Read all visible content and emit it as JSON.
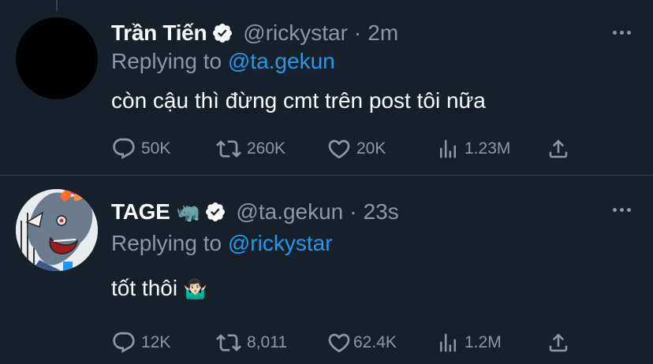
{
  "tweets": [
    {
      "display_name": "Trần Tiến",
      "handle": "@rickystar",
      "separator": "·",
      "time": "2m",
      "replying_prefix": "Replying to",
      "replying_to": "@ta.gekun",
      "text": "còn cậu thì đừng cmt trên post tôi nữa",
      "stats": {
        "replies": "50K",
        "retweets": "260K",
        "likes": "20K",
        "views": "1.23M"
      }
    },
    {
      "display_name": "TAGE",
      "name_emoji": "🦏",
      "handle": "@ta.gekun",
      "separator": "·",
      "time": "23s",
      "replying_prefix": "Replying to",
      "replying_to": "@rickystar",
      "text": "tốt thôi",
      "text_emoji": "🤷🏻‍♂️",
      "stats": {
        "replies": "12K",
        "retweets": "8,011",
        "likes": "62.4K",
        "views": "1.2M"
      }
    }
  ],
  "colors": {
    "background": "#15202b",
    "muted": "#8b98a5",
    "link": "#1d9bf0",
    "divider": "#38444d"
  },
  "icons": [
    "verified-badge-icon",
    "more-icon",
    "reply-icon",
    "retweet-icon",
    "like-icon",
    "views-icon",
    "share-icon"
  ]
}
